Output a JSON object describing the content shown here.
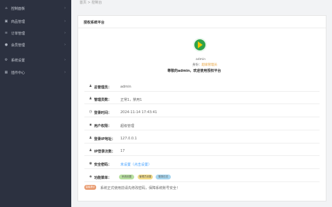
{
  "topbar": {
    "breadcrumb": "首页 > 控制台"
  },
  "sidebar": {
    "items": [
      {
        "label": "控制面板",
        "icon": "home-icon",
        "glyph": "⌂"
      },
      {
        "label": "商品管理",
        "icon": "box-icon",
        "glyph": "▣"
      },
      {
        "label": "订单管理",
        "icon": "list-icon",
        "glyph": "≡"
      },
      {
        "label": "会员管理",
        "icon": "user-icon",
        "glyph": "●"
      },
      {
        "label": "系统设置",
        "icon": "gear-icon",
        "glyph": "⚙"
      },
      {
        "label": "插件中心",
        "icon": "grid-icon",
        "glyph": "▦"
      }
    ]
  },
  "card": {
    "title": "授权系统平台"
  },
  "profile": {
    "name": "admin",
    "role_prefix": "身份：",
    "role": "超级管理员",
    "welcome": "尊敬的admin，欢迎使用授权平台"
  },
  "rows": [
    {
      "icon": "user-icon",
      "glyph": "♟",
      "label": "总管理员：",
      "value": "admin"
    },
    {
      "icon": "users-icon",
      "glyph": "♟",
      "label": "管理员数：",
      "value": "正常1，禁用1"
    },
    {
      "icon": "clock-icon",
      "glyph": "◷",
      "label": "登录时间：",
      "value": "2024-11-14 17:43:41"
    },
    {
      "icon": "device-icon",
      "glyph": "▪",
      "label": "用户权限：",
      "value": "超级管理"
    },
    {
      "icon": "location-icon",
      "glyph": "♟",
      "label": "登录IP地址：",
      "value": "127.0.0.1"
    },
    {
      "icon": "count-icon",
      "glyph": "♟",
      "label": "IP登录次数：",
      "value": "17"
    },
    {
      "icon": "shield-icon",
      "glyph": "◉",
      "label": "安全密码：",
      "value": "未设置（点击设置）"
    }
  ],
  "tags_row": {
    "icon": "tag-icon",
    "glyph": "◈",
    "label": "功能菜单：",
    "tags": [
      "系统设置",
      "管理员设置",
      "登录日志"
    ]
  },
  "notice": {
    "badge": "温馨提示",
    "text": "系统正式使用前请先修改密码，保障系统账号安全！"
  },
  "colors": {
    "sidebar_bg": "#2c3140",
    "logo_green": "#2fa34a",
    "link_blue": "#409eff",
    "notice_orange": "#e8986c"
  }
}
